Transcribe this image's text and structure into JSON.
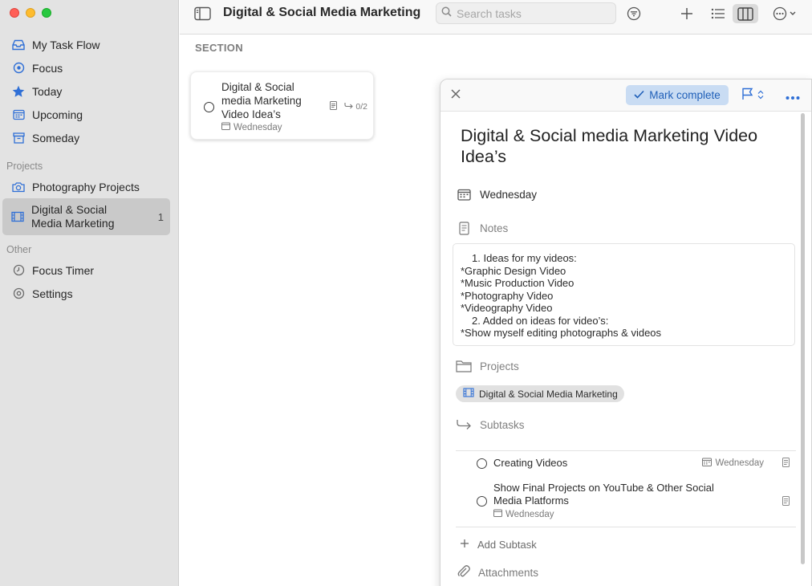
{
  "window": {
    "title": "Digital & Social Media Marketing"
  },
  "sidebar": {
    "main_items": [
      {
        "label": "My Task Flow",
        "icon": "inbox-tray-icon"
      },
      {
        "label": "Focus",
        "icon": "target-icon"
      },
      {
        "label": "Today",
        "icon": "star-icon"
      },
      {
        "label": "Upcoming",
        "icon": "calendar-icon"
      },
      {
        "label": "Someday",
        "icon": "archive-box-icon"
      }
    ],
    "projects_label": "Projects",
    "projects": [
      {
        "label": "Photography Projects",
        "icon": "camera-icon"
      },
      {
        "label": "Digital & Social Media Marketing",
        "icon": "film-strip-icon",
        "count": "1",
        "selected": true
      }
    ],
    "other_label": "Other",
    "other": [
      {
        "label": "Focus Timer",
        "icon": "clock-icon"
      },
      {
        "label": "Settings",
        "icon": "gear-icon"
      }
    ]
  },
  "toolbar": {
    "search_placeholder": "Search tasks",
    "icons": [
      "filter-icon",
      "plus-icon",
      "list-view-icon",
      "board-view-icon",
      "more-options-icon"
    ]
  },
  "board": {
    "section_title": "SECTION",
    "task": {
      "title": "Digital & Social media Marketing Video Idea’s",
      "date": "Wednesday",
      "subtask_progress": "0/2"
    }
  },
  "detail": {
    "mark_complete_label": "Mark complete",
    "title": "Digital & Social media Marketing Video Idea’s",
    "date": "Wednesday",
    "notes_label": "Notes",
    "notes_lines": [
      "1.  Ideas for my videos:",
      "*Graphic Design Video",
      "*Music Production Video",
      "*Photography Video",
      "*Videography Video",
      "2.  Added on ideas for video’s:",
      "*Show myself editing photographs & videos"
    ],
    "projects_label": "Projects",
    "project_chip": "Digital & Social Media Marketing",
    "subtasks_label": "Subtasks",
    "subtasks": [
      {
        "name": "Creating Videos",
        "date": "Wednesday"
      },
      {
        "name": "Show Final Projects on YouTube & Other Social Media Platforms",
        "date": "Wednesday"
      }
    ],
    "add_subtask_label": "Add Subtask",
    "attachments_label": "Attachments"
  },
  "colors": {
    "accent": "#2f6fd6",
    "mark_complete_bg": "#c9dcf3",
    "sidebar_bg": "#e3e3e3"
  }
}
